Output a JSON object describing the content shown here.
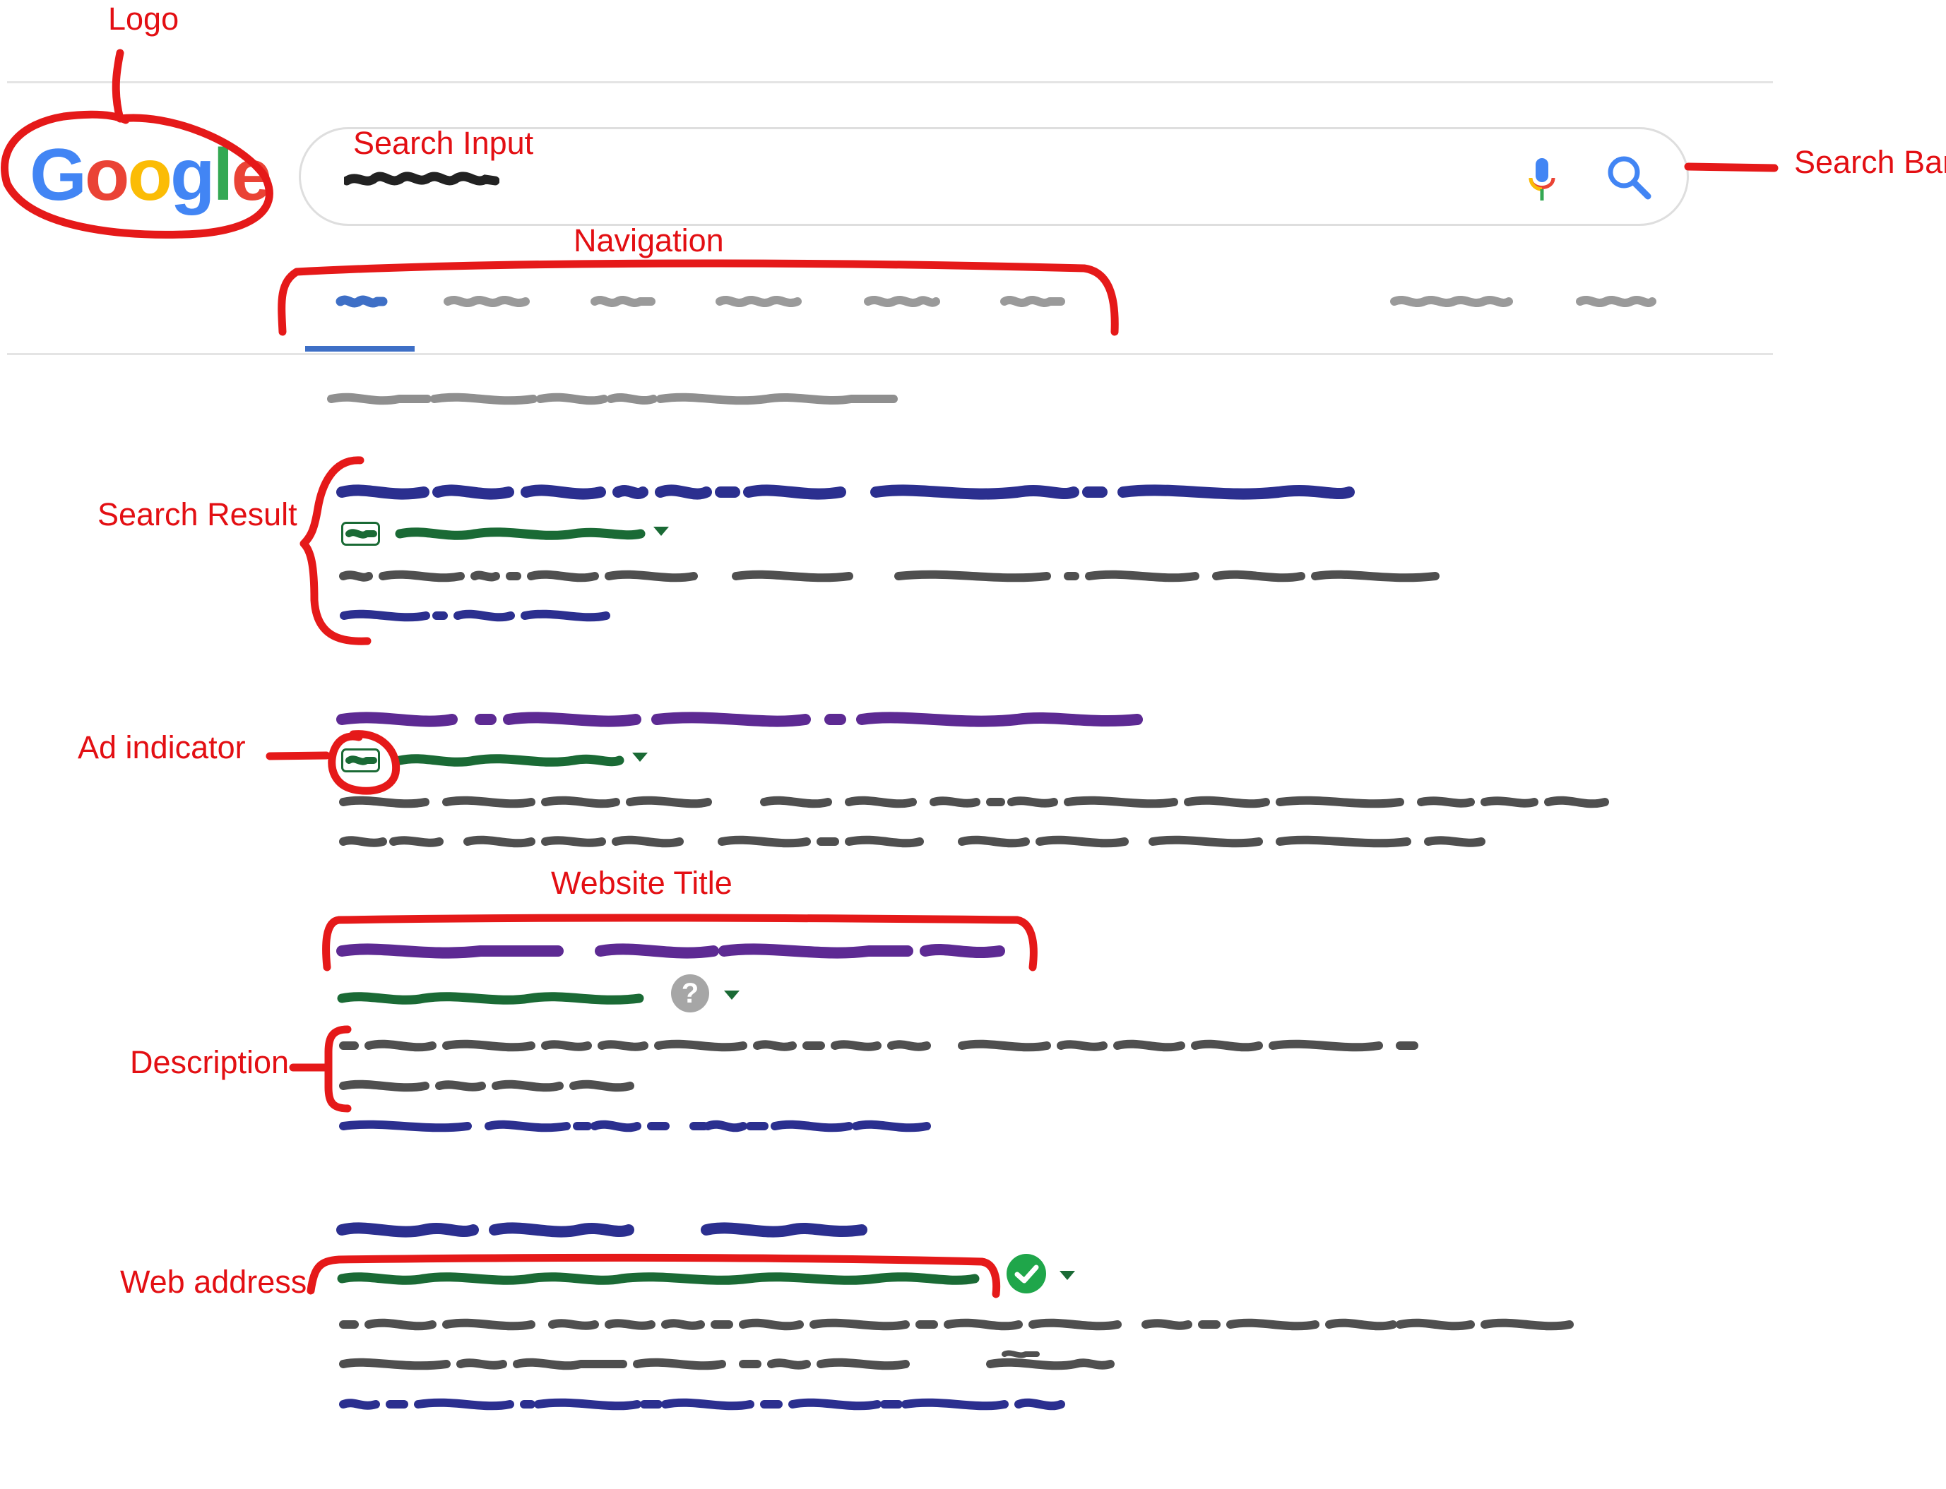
{
  "logo": {
    "letters": [
      "G",
      "o",
      "o",
      "g",
      "l",
      "e"
    ]
  },
  "search": {
    "query_obscured": true
  },
  "annotations": {
    "logo": "Logo",
    "search_input": "Search Input",
    "search_bar": "Search Bar",
    "navigation": "Navigation",
    "search_result": "Search Result",
    "ad_indicator": "Ad indicator",
    "website_title": "Website Title",
    "description": "Description",
    "web_address": "Web address"
  },
  "icons": {
    "mic": "mic-icon",
    "search": "search-icon",
    "help": "help-icon",
    "verified": "verified-check-icon",
    "dropdown": "caret-down-icon"
  },
  "colors": {
    "annotation_red": "#e30f13",
    "title_blue": "#2b2f8f",
    "title_visited_purple": "#5d2a93",
    "url_green": "#1a6a35",
    "snippet_gray": "#4f4f4f",
    "tab_active_blue": "#3e6fc6"
  },
  "help_glyph": "?",
  "content_note_obscured": true
}
